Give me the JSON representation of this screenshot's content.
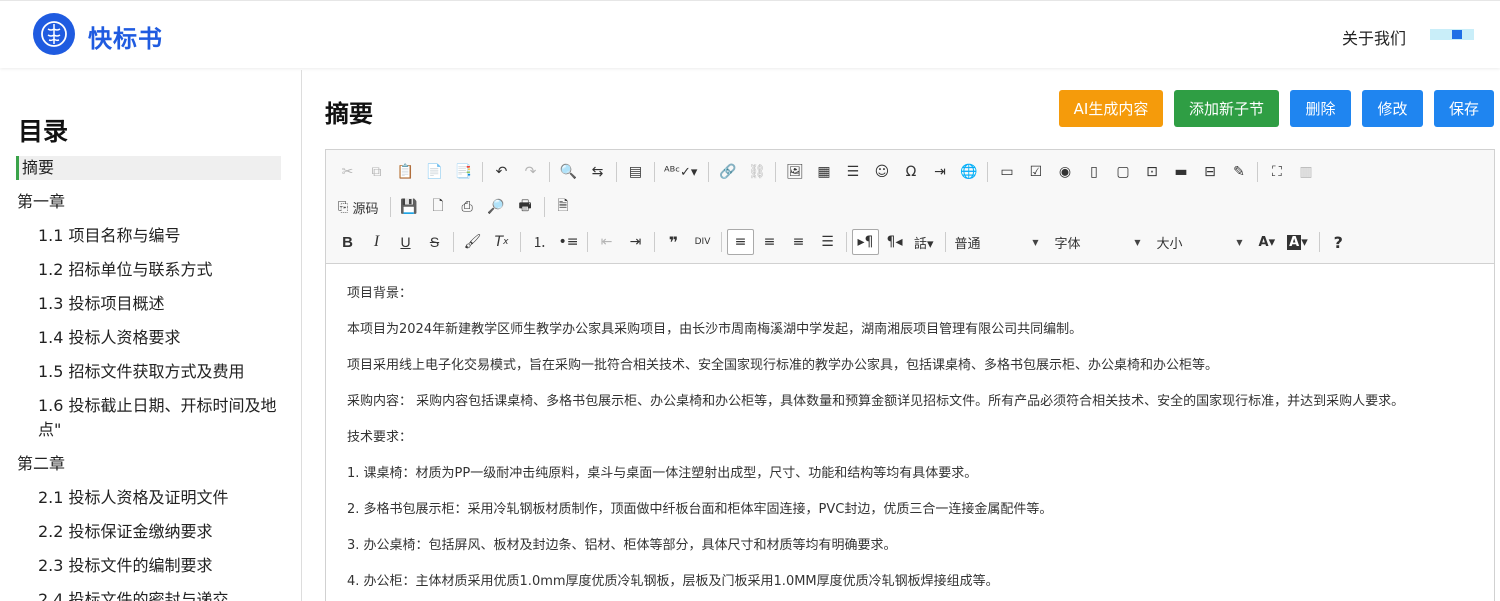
{
  "header": {
    "logo_text": "快标书",
    "about": "关于我们"
  },
  "sidebar": {
    "title": "目录",
    "items": [
      {
        "label": "摘要",
        "level": "active"
      },
      {
        "label": "第一章",
        "level": "chapter"
      },
      {
        "label": "1.1 项目名称与编号",
        "level": "sub"
      },
      {
        "label": "1.2 招标单位与联系方式",
        "level": "sub"
      },
      {
        "label": "1.3 投标项目概述",
        "level": "sub"
      },
      {
        "label": "1.4 投标人资格要求",
        "level": "sub"
      },
      {
        "label": "1.5 招标文件获取方式及费用",
        "level": "sub"
      },
      {
        "label": "1.6 投标截止日期、开标时间及地点\"",
        "level": "sub"
      },
      {
        "label": "第二章",
        "level": "chapter"
      },
      {
        "label": "2.1 投标人资格及证明文件",
        "level": "sub"
      },
      {
        "label": "2.2 投标保证金缴纳要求",
        "level": "sub"
      },
      {
        "label": "2.3 投标文件的编制要求",
        "level": "sub"
      },
      {
        "label": "2.4 投标文件的密封与递交",
        "level": "sub"
      }
    ]
  },
  "main": {
    "title": "摘要",
    "buttons": {
      "ai": "AI生成内容",
      "add": "添加新子节",
      "delete": "删除",
      "edit": "修改",
      "save": "保存"
    }
  },
  "toolbar": {
    "source_label": "源码",
    "format_select": "普通",
    "font_select": "字体",
    "size_select": "大小"
  },
  "editor": {
    "paragraphs": [
      "项目背景：",
      "本项目为2024年新建教学区师生教学办公家具采购项目，由长沙市周南梅溪湖中学发起，湖南湘辰项目管理有限公司共同编制。",
      "项目采用线上电子化交易模式，旨在采购一批符合相关技术、安全国家现行标准的教学办公家具，包括课桌椅、多格书包展示柜、办公桌椅和办公柜等。",
      "采购内容： 采购内容包括课桌椅、多格书包展示柜、办公桌椅和办公柜等，具体数量和预算金额详见招标文件。所有产品必须符合相关技术、安全的国家现行标准，并达到采购人要求。",
      "技术要求：",
      "1. 课桌椅：材质为PP一级耐冲击纯原料，桌斗与桌面一体注塑射出成型，尺寸、功能和结构等均有具体要求。",
      "2. 多格书包展示柜：采用冷轧钢板材质制作，顶面做中纤板台面和柜体牢固连接，PVC封边，优质三合一连接金属配件等。",
      "3. 办公桌椅：包括屏风、板材及封边条、铝材、柜体等部分，具体尺寸和材质等均有明确要求。",
      "4. 办公柜：主体材质采用优质1.0mm厚度优质冷轧钢板，层板及门板采用1.0MM厚度优质冷轧钢板焊接组成等。"
    ]
  }
}
